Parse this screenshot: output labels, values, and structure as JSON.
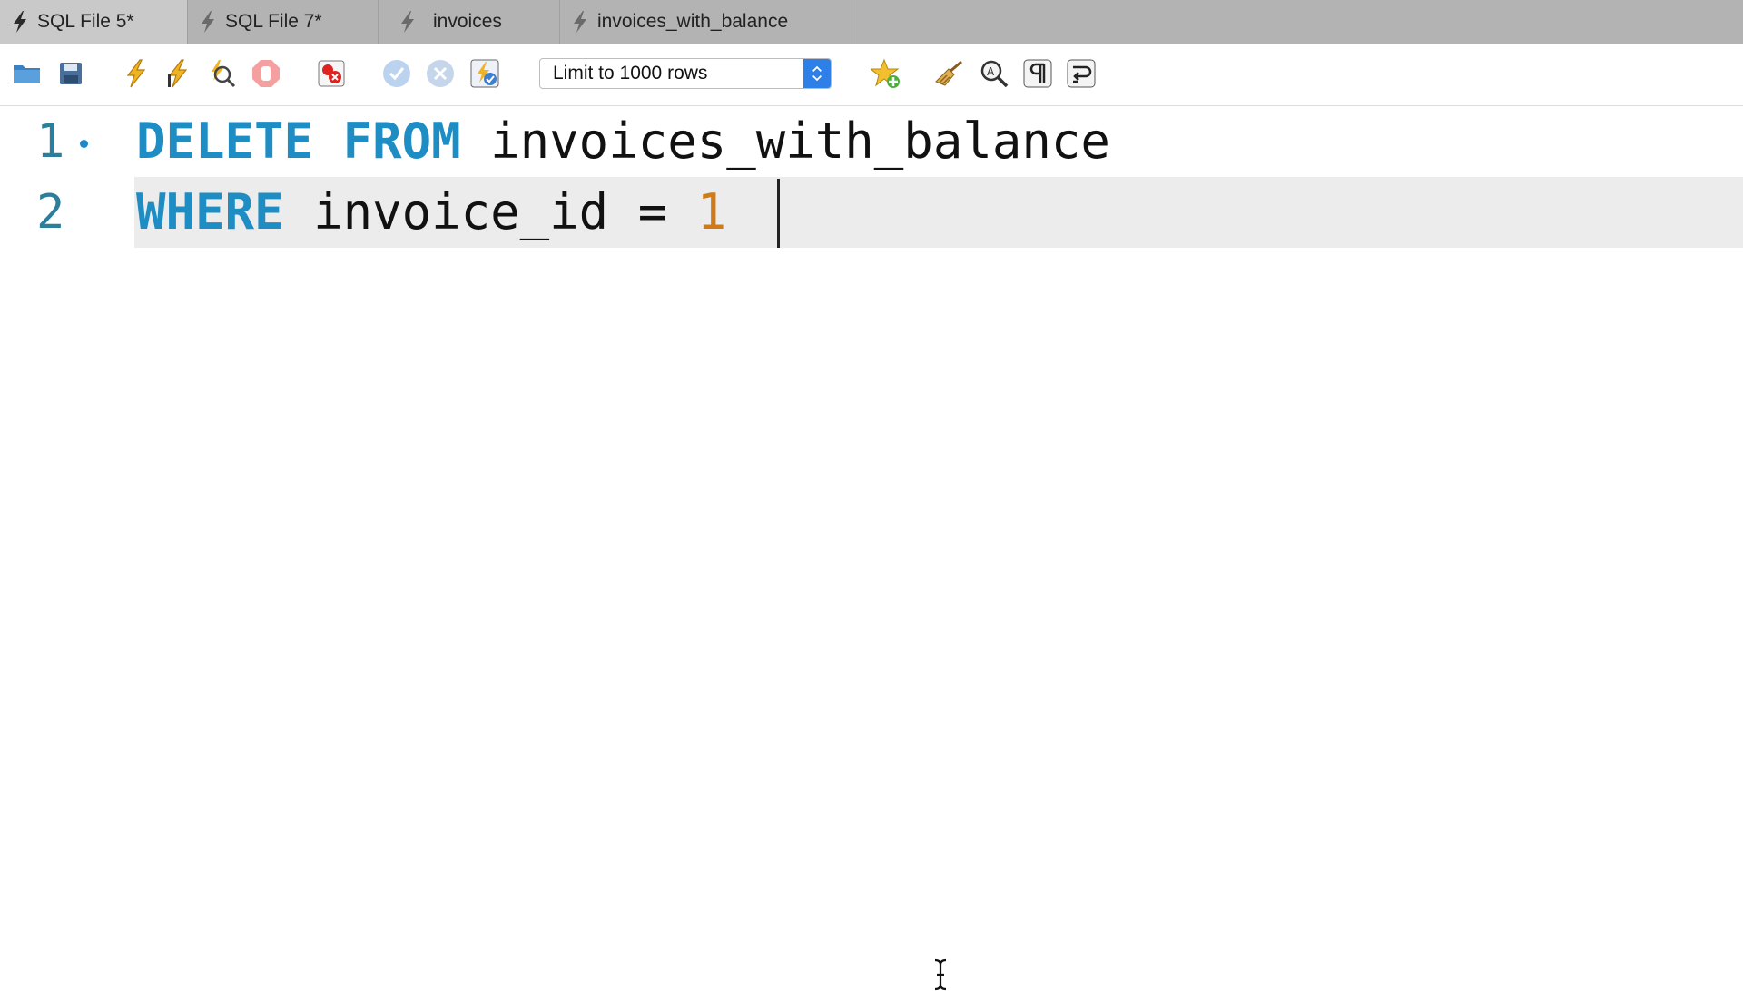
{
  "tabs": [
    {
      "label": "SQL File 5*",
      "active": true
    },
    {
      "label": "SQL File 7*",
      "active": false
    },
    {
      "label": "invoices",
      "active": false
    },
    {
      "label": "invoices_with_balance",
      "active": false
    }
  ],
  "toolbar": {
    "limit_select_value": "Limit to 1000 rows",
    "icons": [
      "folder-open-icon",
      "save-icon",
      "execute-icon",
      "execute-current-icon",
      "explain-icon",
      "stop-icon",
      "toggle-error-icon",
      "commit-icon",
      "rollback-icon",
      "autocommit-icon",
      "bookmark-add-icon",
      "beautify-icon",
      "find-icon",
      "invisible-chars-icon",
      "wrap-icon"
    ]
  },
  "editor": {
    "lines": [
      {
        "number": "1",
        "tokens": [
          {
            "text": "DELETE",
            "type": "keyword"
          },
          {
            "text": " ",
            "type": "plain"
          },
          {
            "text": "FROM",
            "type": "keyword"
          },
          {
            "text": " invoices_with_balance",
            "type": "plain"
          }
        ]
      },
      {
        "number": "2",
        "tokens": [
          {
            "text": "WHERE",
            "type": "keyword"
          },
          {
            "text": " invoice_id = ",
            "type": "plain"
          },
          {
            "text": "1",
            "type": "number"
          },
          {
            "text": " ",
            "type": "plain"
          }
        ]
      }
    ]
  },
  "colors": {
    "keyword": "#1d8dc4",
    "number": "#d07b17",
    "line_number": "#2c7f9c",
    "current_line": "#ececec",
    "select_accent": "#2f7fe8"
  }
}
